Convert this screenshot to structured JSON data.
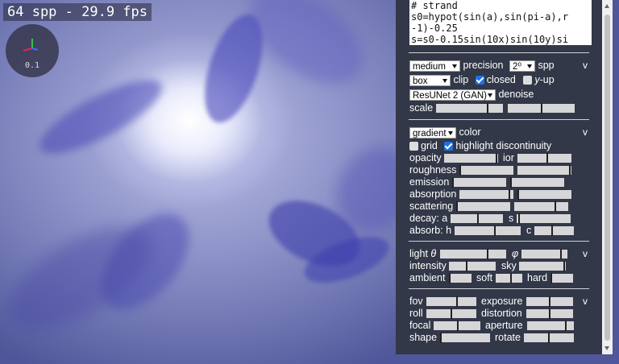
{
  "status": {
    "fps_text": "64 spp - 29.9 fps",
    "gizmo_value": "0.1"
  },
  "colors": {
    "panel": "#333848",
    "axis_x": "#e0245e",
    "axis_y": "#35c24a",
    "axis_z": "#3d6bff"
  },
  "code": {
    "text": "# strand\ns0=hypot(sin(a),sin(pi-a),r\n-1)-0.25\ns=s0-0.15sin(10x)sin(10y)si"
  },
  "render": {
    "precision_value": "medium",
    "precision_label": "precision",
    "spp_value": "2⁰",
    "spp_label": "spp",
    "clip_value": "box",
    "clip_label": "clip",
    "closed_label": "closed",
    "closed_checked": true,
    "yup_prefix": "y",
    "yup_label": "-up",
    "yup_checked": false,
    "denoise_value": "ResUNet 2 (GAN)",
    "denoise_label": "denoise",
    "scale_label": "scale",
    "collapse": "v"
  },
  "material": {
    "color_value": "gradient",
    "color_label": "color",
    "grid_label": "grid",
    "grid_checked": false,
    "highlight_label": "highlight discontinuity",
    "highlight_checked": true,
    "opacity": "opacity",
    "ior": "ior",
    "roughness": "roughness",
    "emission": "emission",
    "absorption": "absorption",
    "scattering": "scattering",
    "decay_a": "decay: a",
    "decay_s": "s",
    "absorb_h": "absorb: h",
    "absorb_c": "c",
    "collapse": "v"
  },
  "light": {
    "light_prefix": "light ",
    "theta": "θ",
    "phi": "φ",
    "intensity": "intensity",
    "sky": "sky",
    "ambient": "ambient",
    "soft": "soft",
    "hard": "hard",
    "collapse": "v"
  },
  "camera": {
    "fov": "fov",
    "exposure": "exposure",
    "roll": "roll",
    "distortion": "distortion",
    "focal": "focal",
    "aperture": "aperture",
    "shape": "shape",
    "rotate": "rotate",
    "collapse": "v"
  },
  "sliders": {
    "scale_1": 0.77,
    "scale_2": 0.5,
    "opacity": 0.97,
    "ior": 0.55,
    "roughness": 0.02,
    "roughness_2": 0.97,
    "emission": 0.02,
    "emission_2": 0.02,
    "absorption": 0.93,
    "absorption_2": 0.02,
    "scattering": 0.02,
    "scattering_2": 0.76,
    "decay_a": 0.52,
    "decay_s": 0.05,
    "absorb_h": 0.61,
    "absorb_c": 0.44,
    "light_theta": 0.72,
    "light_phi": 0.86,
    "intensity": 0.38,
    "sky": 0.97,
    "ambient": 0.02,
    "soft": 0.58,
    "hard": 0.02,
    "fov": 0.62,
    "exposure": 0.5,
    "roll": 0.5,
    "distortion": 0.5,
    "focal": 0.52,
    "aperture": 0.82,
    "shape": 0.02,
    "rotate": 0.5
  }
}
